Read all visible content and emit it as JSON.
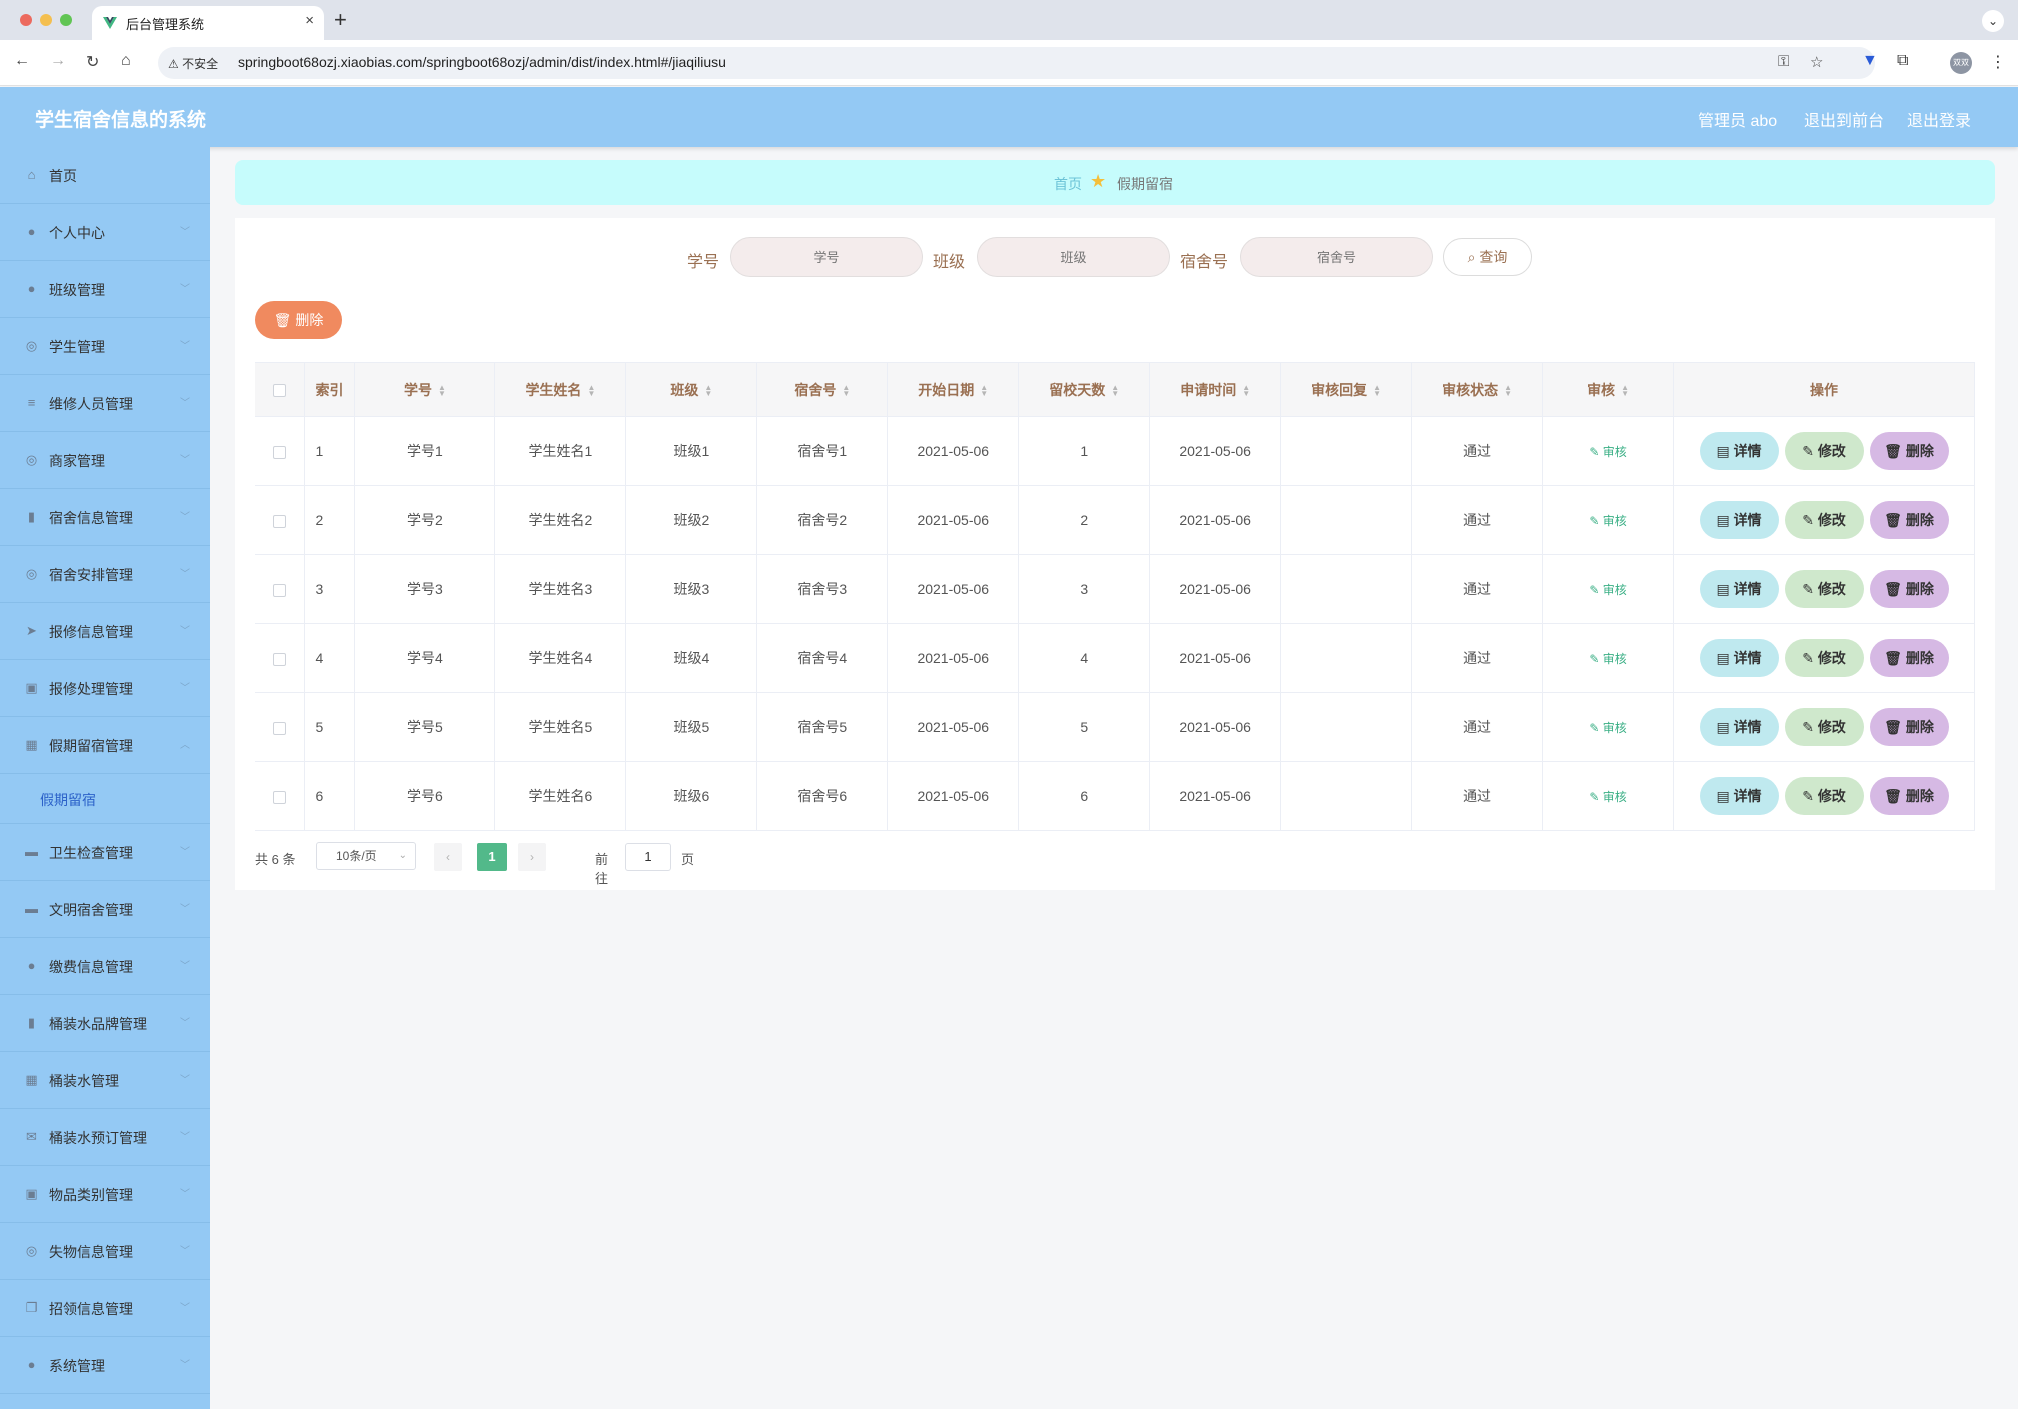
{
  "browser": {
    "tab_title": "后台管理系统",
    "new_tab": "+",
    "close": "×",
    "insecure_label": "不安全",
    "url": "springboot68ozj.xiaobias.com/springboot68ozj/admin/dist/index.html#/jiaqiliusu",
    "profile": "双双"
  },
  "header": {
    "title": "学生宿舍信息的系统",
    "user": "管理员 abo",
    "to_front": "退出到前台",
    "logout": "退出登录"
  },
  "sidebar": {
    "items": [
      {
        "label": "首页",
        "icon": "home-icon",
        "glyph": "⌂"
      },
      {
        "label": "个人中心",
        "icon": "user-icon",
        "glyph": "●"
      },
      {
        "label": "班级管理",
        "icon": "user-icon",
        "glyph": "●"
      },
      {
        "label": "学生管理",
        "icon": "compass-icon",
        "glyph": "◎"
      },
      {
        "label": "维修人员管理",
        "icon": "sliders-icon",
        "glyph": "≡"
      },
      {
        "label": "商家管理",
        "icon": "globe-icon",
        "glyph": "◎"
      },
      {
        "label": "宿舍信息管理",
        "icon": "bar-chart-icon",
        "glyph": "▮"
      },
      {
        "label": "宿舍安排管理",
        "icon": "globe-icon",
        "glyph": "◎"
      },
      {
        "label": "报修信息管理",
        "icon": "send-icon",
        "glyph": "➤"
      },
      {
        "label": "报修处理管理",
        "icon": "clipboard-icon",
        "glyph": "▣"
      },
      {
        "label": "假期留宿管理",
        "icon": "grid-icon",
        "glyph": "▦"
      },
      {
        "label": "卫生检查管理",
        "icon": "cup-icon",
        "glyph": "▬"
      },
      {
        "label": "文明宿舍管理",
        "icon": "monitor-icon",
        "glyph": "▬"
      },
      {
        "label": "缴费信息管理",
        "icon": "user-icon",
        "glyph": "●"
      },
      {
        "label": "桶装水品牌管理",
        "icon": "bar-chart-icon",
        "glyph": "▮"
      },
      {
        "label": "桶装水管理",
        "icon": "grid-icon",
        "glyph": "▦"
      },
      {
        "label": "桶装水预订管理",
        "icon": "mail-icon",
        "glyph": "✉"
      },
      {
        "label": "物品类别管理",
        "icon": "clipboard-icon",
        "glyph": "▣"
      },
      {
        "label": "失物信息管理",
        "icon": "compass-icon",
        "glyph": "◎"
      },
      {
        "label": "招领信息管理",
        "icon": "copy-icon",
        "glyph": "❐"
      },
      {
        "label": "系统管理",
        "icon": "mic-icon",
        "glyph": "●"
      }
    ],
    "sub_item": "假期留宿",
    "chevron_down": "﹀",
    "chevron_up": "︿"
  },
  "breadcrumb": {
    "home": "首页",
    "current": "假期留宿",
    "star": "★"
  },
  "search": {
    "label_id": "学号",
    "placeholder_id": "学号",
    "label_class": "班级",
    "placeholder_class": "班级",
    "label_room": "宿舍号",
    "placeholder_room": "宿舍号",
    "button": "查询"
  },
  "toolbar": {
    "delete": "删除"
  },
  "table": {
    "headers": {
      "index": "索引",
      "student_id": "学号",
      "name": "学生姓名",
      "class": "班级",
      "room": "宿舍号",
      "start_date": "开始日期",
      "days": "留校天数",
      "apply_time": "申请时间",
      "reply": "审核回复",
      "status": "审核状态",
      "audit": "审核",
      "ops": "操作"
    },
    "sort_glyph": "▲▼",
    "audit_label": "审核",
    "btn_detail": "详情",
    "btn_edit": "修改",
    "btn_delete": "删除",
    "rows": [
      {
        "index": "1",
        "student_id": "学号1",
        "name": "学生姓名1",
        "class": "班级1",
        "room": "宿舍号1",
        "start_date": "2021-05-06",
        "days": "1",
        "apply_time": "2021-05-06",
        "reply": "",
        "status": "通过"
      },
      {
        "index": "2",
        "student_id": "学号2",
        "name": "学生姓名2",
        "class": "班级2",
        "room": "宿舍号2",
        "start_date": "2021-05-06",
        "days": "2",
        "apply_time": "2021-05-06",
        "reply": "",
        "status": "通过"
      },
      {
        "index": "3",
        "student_id": "学号3",
        "name": "学生姓名3",
        "class": "班级3",
        "room": "宿舍号3",
        "start_date": "2021-05-06",
        "days": "3",
        "apply_time": "2021-05-06",
        "reply": "",
        "status": "通过"
      },
      {
        "index": "4",
        "student_id": "学号4",
        "name": "学生姓名4",
        "class": "班级4",
        "room": "宿舍号4",
        "start_date": "2021-05-06",
        "days": "4",
        "apply_time": "2021-05-06",
        "reply": "",
        "status": "通过"
      },
      {
        "index": "5",
        "student_id": "学号5",
        "name": "学生姓名5",
        "class": "班级5",
        "room": "宿舍号5",
        "start_date": "2021-05-06",
        "days": "5",
        "apply_time": "2021-05-06",
        "reply": "",
        "status": "通过"
      },
      {
        "index": "6",
        "student_id": "学号6",
        "name": "学生姓名6",
        "class": "班级6",
        "room": "宿舍号6",
        "start_date": "2021-05-06",
        "days": "6",
        "apply_time": "2021-05-06",
        "reply": "",
        "status": "通过"
      }
    ]
  },
  "pagination": {
    "total": "共 6 条",
    "page_size": "10条/页",
    "prev": "‹",
    "next": "›",
    "current": "1",
    "goto": "前往",
    "goto_value": "1",
    "page_suffix": "页"
  },
  "colors": {
    "header_bg": "#94c9f4",
    "breadcrumb_bg": "#c6fcfc",
    "accent_green": "#52b98a",
    "delete_orange": "#f08a5f"
  }
}
